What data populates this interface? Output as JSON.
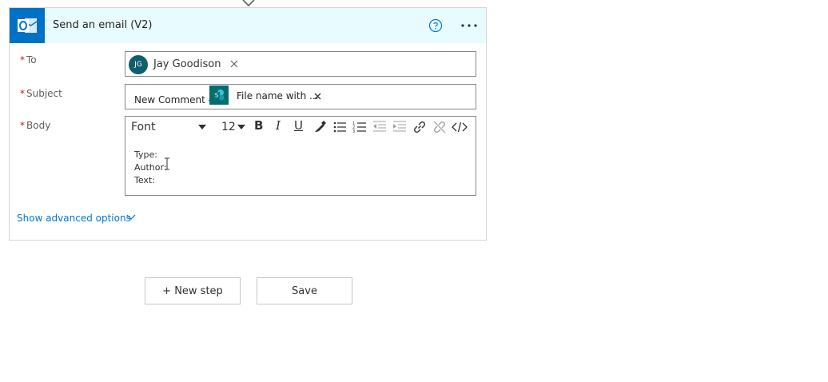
{
  "action_card": {
    "title": "Send an email (V2)",
    "icon": "outlook-icon",
    "header_color": "#e8fbff",
    "icon_tile_color": "#0072c6",
    "help_icon": "help-icon",
    "more_icon": "more-options-icon"
  },
  "fields": {
    "to": {
      "required_marker": "*",
      "label": "To",
      "recipient": {
        "initials": "JG",
        "name": "Jay Goodison"
      }
    },
    "subject": {
      "required_marker": "*",
      "label": "Subject",
      "text": "New Comment - ",
      "token": {
        "label": "File name with ...",
        "icon": "sharepoint-icon"
      }
    },
    "body": {
      "required_marker": "*",
      "label": "Body",
      "toolbar": {
        "font": "Font",
        "size": "12",
        "bold": "B",
        "italic": "I",
        "underline": "U"
      },
      "lines": [
        "Type:",
        "Author:",
        "Text:"
      ]
    }
  },
  "advanced_options": {
    "label": "Show advanced options"
  },
  "footer": {
    "new_step_label": "+ New step",
    "save_label": "Save"
  },
  "colors": {
    "accent": "#0078d4",
    "required": "#a4262c",
    "avatar": "#0f5e6e",
    "sharepoint": "#036c70"
  }
}
